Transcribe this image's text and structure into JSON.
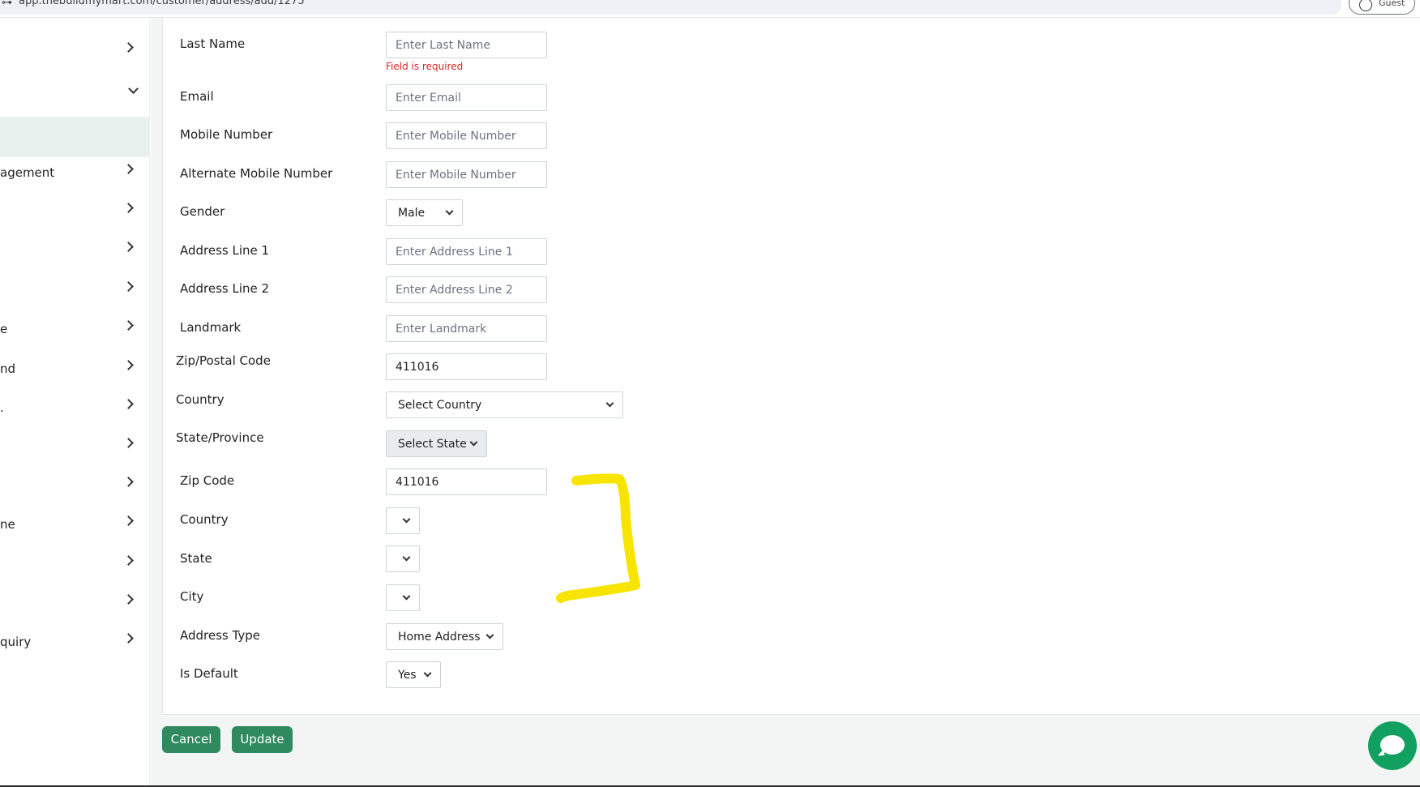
{
  "browser": {
    "url": "app.thebuildmymart.com/customer/address/add/1275",
    "guest_label": "Guest"
  },
  "sidebar": {
    "items": [
      {
        "label": "",
        "chevron": "right"
      },
      {
        "label": "",
        "chevron": "down"
      },
      {
        "label": "agement",
        "chevron": "right"
      },
      {
        "label": "",
        "chevron": "right"
      },
      {
        "label": "",
        "chevron": "right"
      },
      {
        "label": "",
        "chevron": "right"
      },
      {
        "label": "e",
        "chevron": "right"
      },
      {
        "label": "nd",
        "chevron": "right"
      },
      {
        "label": ".",
        "chevron": "right"
      },
      {
        "label": "",
        "chevron": "right"
      },
      {
        "label": "",
        "chevron": "right"
      },
      {
        "label": "ne",
        "chevron": "right"
      },
      {
        "label": "",
        "chevron": "right"
      },
      {
        "label": "",
        "chevron": "right"
      },
      {
        "label": "quiry",
        "chevron": "right"
      }
    ]
  },
  "form": {
    "last_name": {
      "label": "Last Name",
      "placeholder": "Enter Last Name",
      "error": "Field is required"
    },
    "email": {
      "label": "Email",
      "placeholder": "Enter Email"
    },
    "mobile": {
      "label": "Mobile Number",
      "placeholder": "Enter Mobile Number"
    },
    "alt_mobile": {
      "label": "Alternate Mobile Number",
      "placeholder": "Enter Mobile Number"
    },
    "gender": {
      "label": "Gender",
      "value": "Male"
    },
    "address1": {
      "label": "Address Line 1",
      "placeholder": "Enter Address Line 1"
    },
    "address2": {
      "label": "Address Line 2",
      "placeholder": "Enter Address Line 2"
    },
    "landmark": {
      "label": "Landmark",
      "placeholder": "Enter Landmark"
    },
    "zip_postal": {
      "label": "Zip/Postal Code",
      "value": "411016"
    },
    "country_select": {
      "label": "Country",
      "value": "Select Country"
    },
    "state_province": {
      "label": "State/Province",
      "value": "Select State"
    },
    "zip_code": {
      "label": "Zip Code",
      "value": "411016"
    },
    "country": {
      "label": "Country",
      "value": ""
    },
    "state": {
      "label": "State",
      "value": ""
    },
    "city": {
      "label": "City",
      "value": ""
    },
    "address_type": {
      "label": "Address Type",
      "value": "Home Address"
    },
    "is_default": {
      "label": "Is Default",
      "value": "Yes"
    }
  },
  "actions": {
    "cancel": "Cancel",
    "update": "Update"
  },
  "colors": {
    "primary_button": "#2f8a5f",
    "error_text": "#dc2626",
    "annotation": "#f7e400",
    "chat": "#11a05f"
  },
  "icons": [
    "chevron-right-icon",
    "chevron-down-icon",
    "chat-icon",
    "user-circle-icon",
    "site-info-icon"
  ]
}
